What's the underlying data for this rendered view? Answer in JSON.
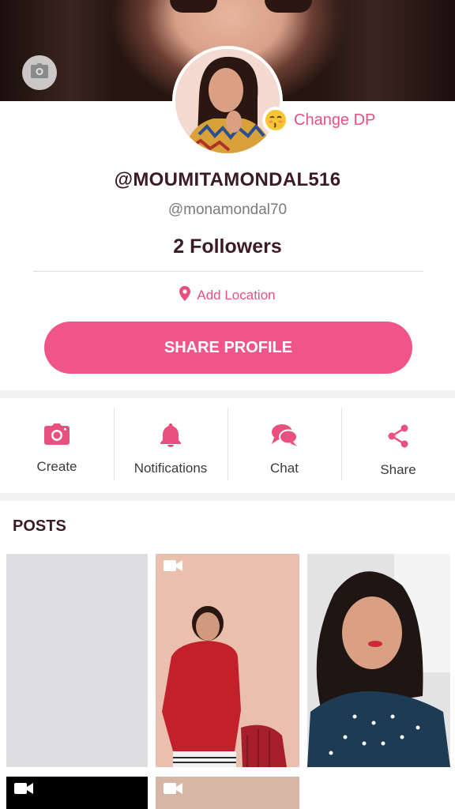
{
  "profile": {
    "username": "@MOUMITAMONDAL516",
    "handle": "@monamondal70",
    "followers": "2 Followers",
    "change_dp_label": "Change DP",
    "add_location_label": "Add Location",
    "share_profile_label": "SHARE PROFILE"
  },
  "actions": [
    {
      "label": "Create",
      "icon": "camera-icon"
    },
    {
      "label": "Notifications",
      "icon": "bell-icon"
    },
    {
      "label": "Chat",
      "icon": "chat-icon"
    },
    {
      "label": "Share",
      "icon": "share-icon"
    }
  ],
  "posts": {
    "title": "POSTS"
  },
  "colors": {
    "accent": "#ef5589",
    "accent_text": "#e8507f",
    "title_text": "#3b1a28"
  }
}
